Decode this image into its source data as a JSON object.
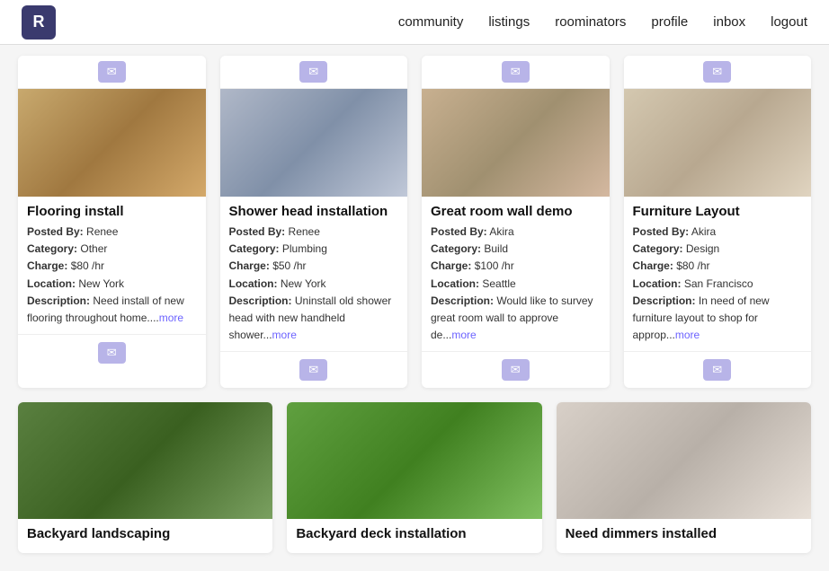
{
  "nav": {
    "logo_letter": "R",
    "links": [
      {
        "label": "community",
        "href": "#"
      },
      {
        "label": "listings",
        "href": "#"
      },
      {
        "label": "roominators",
        "href": "#"
      },
      {
        "label": "profile",
        "href": "#"
      },
      {
        "label": "inbox",
        "href": "#"
      },
      {
        "label": "logout",
        "href": "#"
      }
    ]
  },
  "cards_row1": [
    {
      "id": "flooring-install",
      "img_class": "img-flooring",
      "title": "Flooring install",
      "posted_by": "Renee",
      "category": "Other",
      "charge": "$80 /hr",
      "location": "New York",
      "description": "Need install of new flooring throughout home....",
      "more": "more"
    },
    {
      "id": "shower-head",
      "img_class": "img-shower",
      "title": "Shower head installation",
      "posted_by": "Renee",
      "category": "Plumbing",
      "charge": "$50 /hr",
      "location": "New York",
      "description": "Uninstall old shower head with new handheld shower...",
      "more": "more"
    },
    {
      "id": "great-room",
      "img_class": "img-greatroom",
      "title": "Great room wall demo",
      "posted_by": "Akira",
      "category": "Build",
      "charge": "$100 /hr",
      "location": "Seattle",
      "description": "Would like to survey great room wall to approve de...",
      "more": "more"
    },
    {
      "id": "furniture-layout",
      "img_class": "img-furniture",
      "title": "Furniture Layout",
      "posted_by": "Akira",
      "category": "Design",
      "charge": "$80 /hr",
      "location": "San Francisco",
      "description": "In need of new furniture layout to shop for approp...",
      "more": "more"
    }
  ],
  "cards_row2": [
    {
      "id": "backyard-landscaping",
      "img_class": "img-backyard",
      "title": "Backyard landscaping",
      "posted_by": "",
      "category": "",
      "charge": "",
      "location": "",
      "description": "",
      "more": ""
    },
    {
      "id": "backyard-deck",
      "img_class": "img-deck",
      "title": "Backyard deck installation",
      "posted_by": "",
      "category": "",
      "charge": "",
      "location": "",
      "description": "",
      "more": ""
    },
    {
      "id": "dimmers-installed",
      "img_class": "img-dimmers",
      "title": "Need dimmers installed",
      "posted_by": "",
      "category": "",
      "charge": "",
      "location": "",
      "description": "",
      "more": ""
    }
  ],
  "labels": {
    "posted_by": "Posted By:",
    "category": "Category:",
    "charge": "Charge:",
    "location": "Location:",
    "description": "Description:"
  }
}
